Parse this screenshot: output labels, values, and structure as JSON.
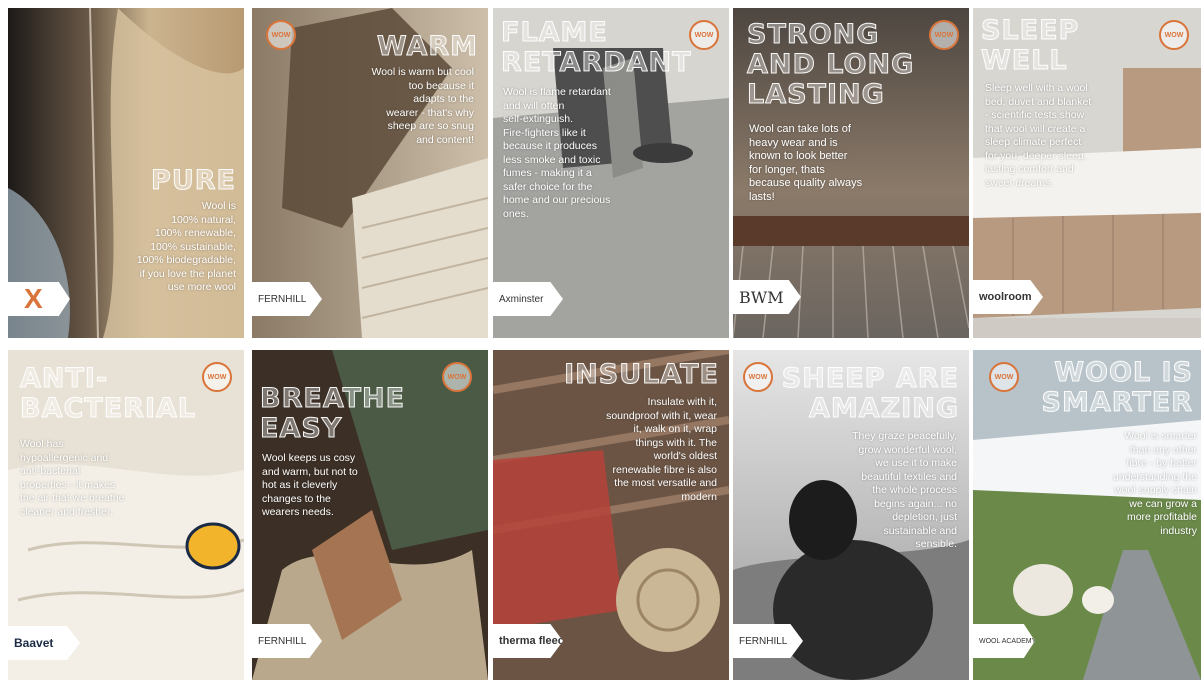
{
  "colors": {
    "accent": "#d9743a",
    "title_fill": "#ffffff"
  },
  "posters": [
    {
      "title": "PURE",
      "body": "Wool is\n100% natural,\n100% renewable,\n100% sustainable,\n100% biodegradable,\nif you love the planet\nuse more wool",
      "logo": "X",
      "badge": ""
    },
    {
      "title": "WARM",
      "body": "Wool is warm but cool\ntoo because it\nadapts to the\nwearer - that's why\nsheep are so snug\nand content!",
      "logo": "FERNHILL",
      "badge": "WOW"
    },
    {
      "title": "FLAME\nRETARDANT",
      "body": "Wool is flame retardant\nand will often\nself-extinguish.\nFire-fighters like it\nbecause it produces\nless smoke and toxic\nfumes - making it a\nsafer choice for the\nhome and our precious\nones.",
      "logo": "Axminster",
      "badge": "WOW"
    },
    {
      "title": "STRONG\nAND LONG\nLASTING",
      "body": "Wool can take lots of\nheavy wear and is\nknown to look better\nfor longer, thats\nbecause quality always\nlasts!",
      "logo": "BWM",
      "badge": "WOW"
    },
    {
      "title": "SLEEP\nWELL",
      "body": "Sleep well with a wool\nbed, duvet and blanket\n- scientific tests show\nthat wool will create a\nsleep climate perfect\nfor you, deeper sleep,\nlasting comfort and\nsweet dreams.",
      "logo": "woolroom",
      "badge": "WOW"
    },
    {
      "title": "ANTI-\nBACTERIAL",
      "body": "Wool has\nhypoallergenic and\nanti-bacterial\nproperties - it makes\nthe air that we breathe\ncleaner and fresher.",
      "logo": "Baavet",
      "badge": "WOW"
    },
    {
      "title": "BREATHE\nEASY",
      "body": "Wool keeps us cosy\nand warm, but not to\nhot as it cleverly\nchanges to the\nwearers needs.",
      "logo": "FERNHILL",
      "badge": "WOW"
    },
    {
      "title": "INSULATE",
      "body": "Insulate with it,\nsoundproof with it, wear\nit, walk on it, wrap\nthings with it. The\nworld's oldest\nrenewable fibre is also\nthe most versatile and\nmodern",
      "logo": "therma fleece.",
      "badge": ""
    },
    {
      "title": "SHEEP ARE\nAMAZING",
      "body": "They graze peacefully,\ngrow wonderful wool,\nwe use it to make\nbeautiful textiles and\nthe whole process\nbegins again... no\ndepletion, just\nsustainable and\nsensible.",
      "logo": "FERNHILL",
      "badge": "WOW"
    },
    {
      "title": "WOOL IS\nSMARTER",
      "body": "Wool is smarter\nthan any other\nfibre - by better\nunderstanding the\nwool supply chain\nwe can grow a\nmore profitable\nindustry",
      "logo": "WOOL ACADEMY",
      "badge": "WOW"
    }
  ]
}
